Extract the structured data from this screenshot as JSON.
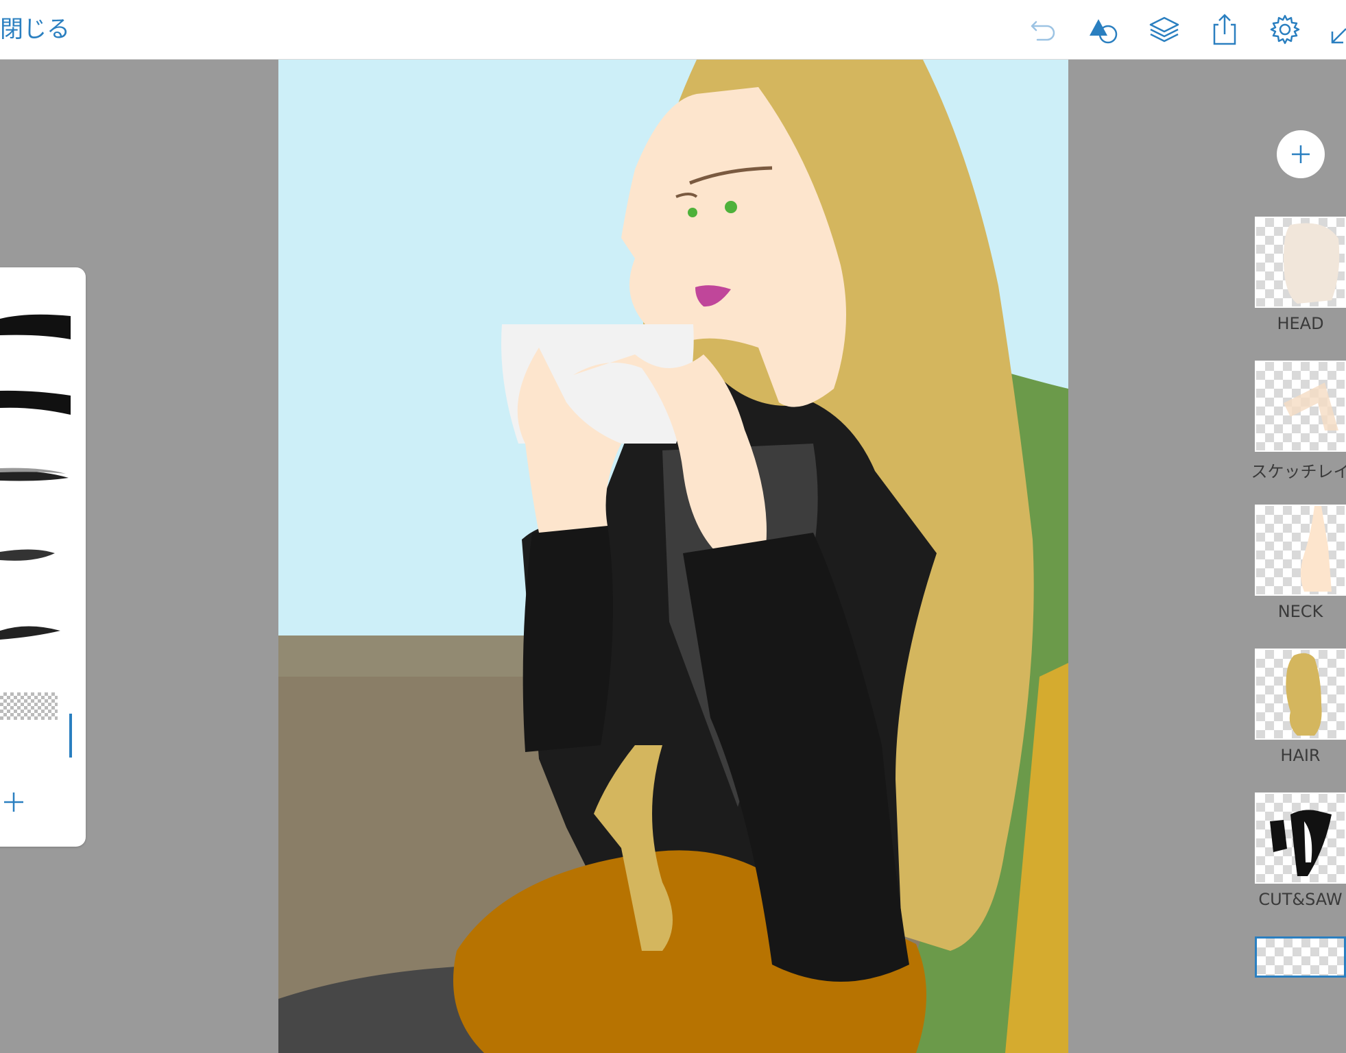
{
  "toolbar": {
    "close_label": "閉じる",
    "icons": [
      "undo-icon",
      "shapes-icon",
      "layers-icon",
      "share-icon",
      "settings-icon",
      "collapse-icon"
    ]
  },
  "brushes": {
    "items": [
      {
        "name": "brush-1"
      },
      {
        "name": "brush-2"
      },
      {
        "name": "brush-3"
      },
      {
        "name": "brush-4"
      },
      {
        "name": "brush-5"
      },
      {
        "name": "brush-6"
      }
    ],
    "selected_index": 5
  },
  "layers": {
    "items": [
      {
        "name": "HEAD"
      },
      {
        "name": "スケッチレイ"
      },
      {
        "name": "NECK"
      },
      {
        "name": "HAIR"
      },
      {
        "name": "CUT&SAW"
      },
      {
        "name": ""
      }
    ]
  },
  "colors": {
    "accent": "#2a7fc0",
    "background": "#9a9a9a",
    "sky": "#cdeff8",
    "hair": "#d4b65e",
    "skin": "#fde5cd",
    "top": "#1c1c1c",
    "skirt": "#b77301",
    "chair": "#6b9a4a",
    "floor": "#8a7e67"
  }
}
